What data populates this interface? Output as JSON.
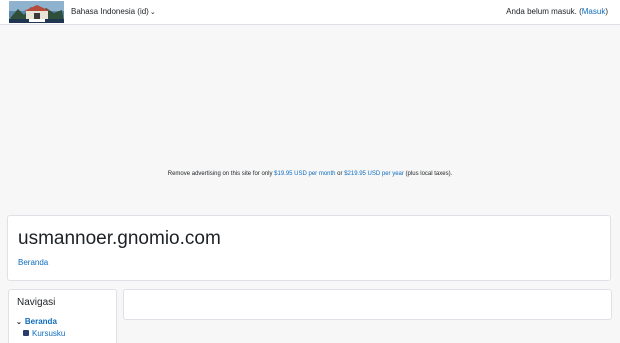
{
  "navbar": {
    "language": "Bahasa Indonesia (id)",
    "login_prefix": "Anda belum masuk. (",
    "login_link": "Masuk",
    "login_suffix": ")"
  },
  "ad": {
    "prefix": "Remove advertising on this site for only ",
    "monthly": "$19.95 USD per month",
    "or": " or ",
    "yearly": "$219.95 USD per year",
    "suffix": " (plus local taxes)."
  },
  "header": {
    "site_title": "usmannoer.gnomio.com",
    "breadcrumb": "Beranda"
  },
  "navigation": {
    "title": "Navigasi",
    "home": "Beranda",
    "courses": "Kursusku"
  },
  "colors": {
    "link": "#0f6cbf",
    "text": "#1d2125",
    "background": "#f7f7f7"
  }
}
